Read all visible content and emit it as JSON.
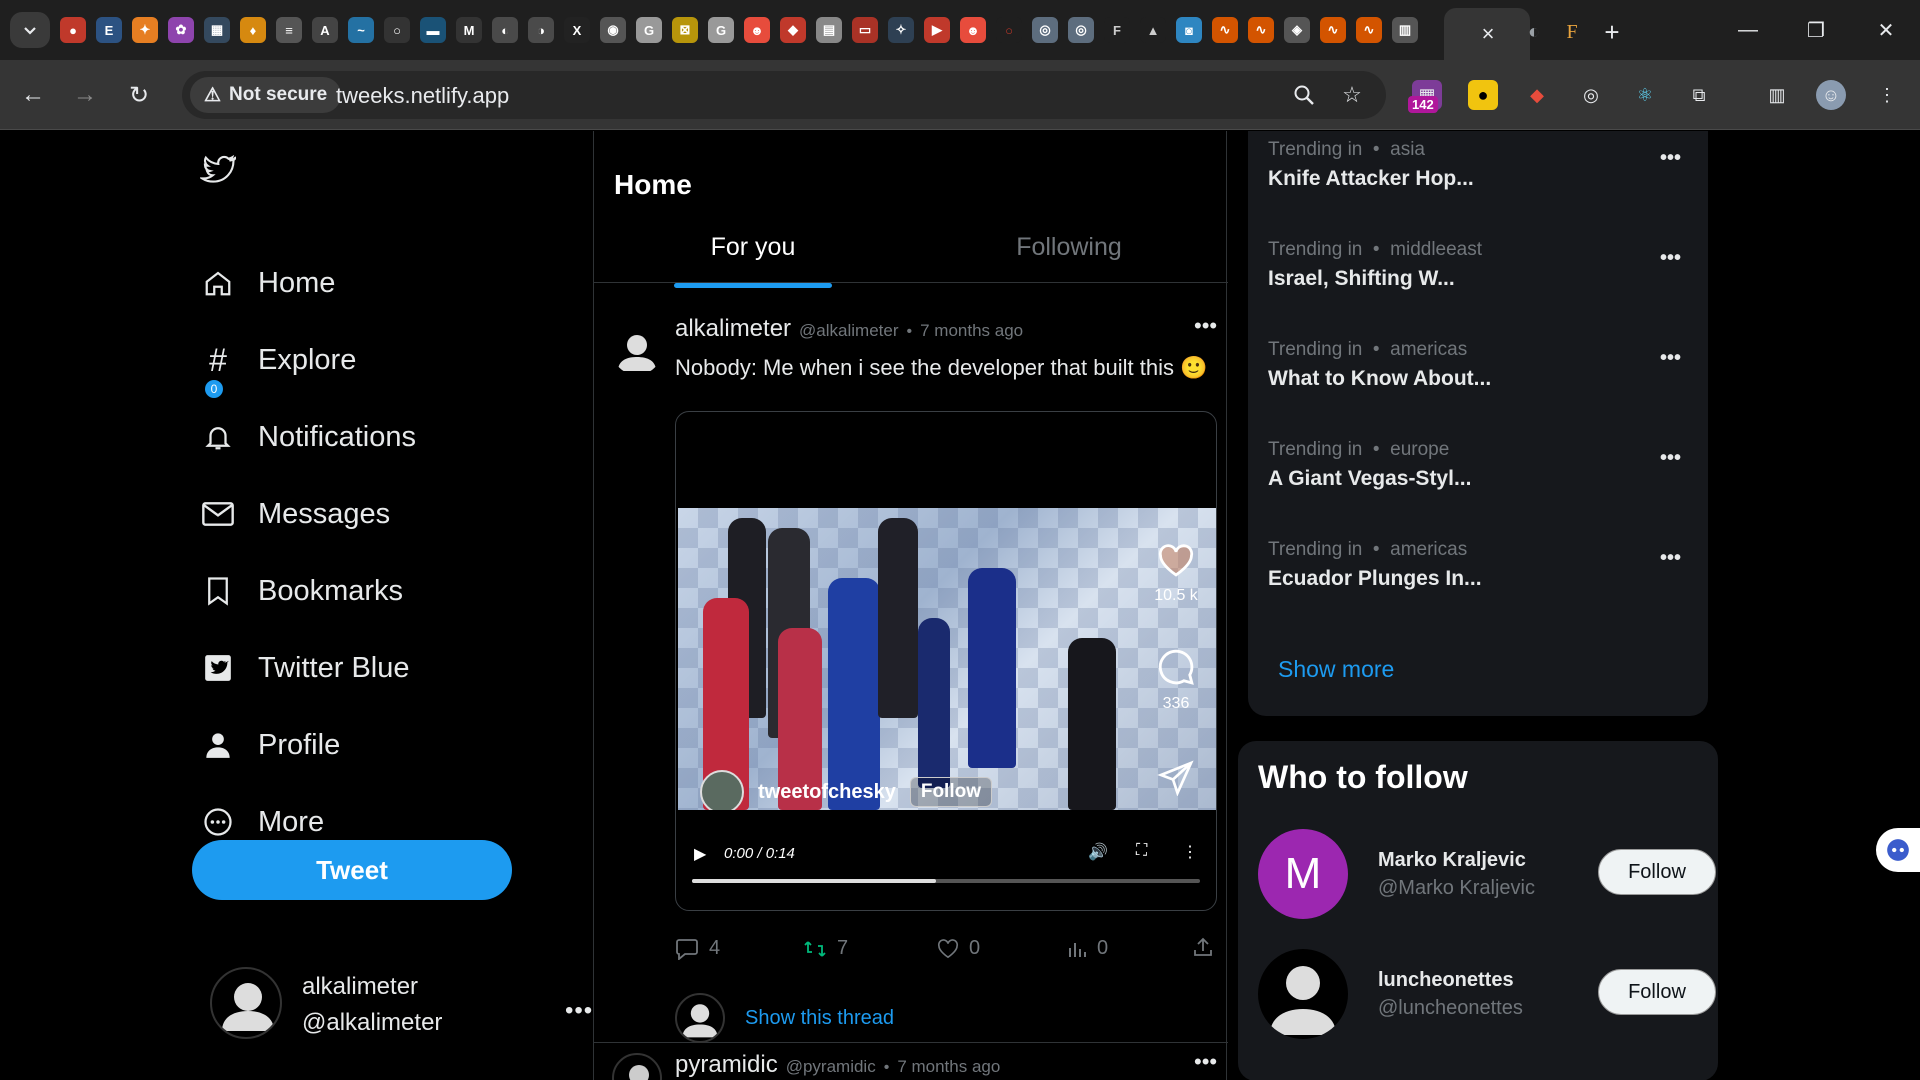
{
  "browser": {
    "tab_menu_icon": "chevron-down-icon",
    "active_tab_close": "×",
    "new_tab": "+",
    "window": {
      "minimize": "—",
      "restore": "❐",
      "close": "✕"
    },
    "security_label": "Not secure",
    "url": "tweeks.netlify.app",
    "extensions_badge": "142"
  },
  "sidebar": {
    "items": [
      {
        "label": "Home",
        "icon": "home-icon"
      },
      {
        "label": "Explore",
        "icon": "hashtag-icon"
      },
      {
        "label": "Notifications",
        "icon": "bell-icon"
      },
      {
        "label": "Messages",
        "icon": "mail-icon"
      },
      {
        "label": "Bookmarks",
        "icon": "bookmark-icon"
      },
      {
        "label": "Twitter Blue",
        "icon": "twitter-blue-icon"
      },
      {
        "label": "Profile",
        "icon": "person-icon"
      },
      {
        "label": "More",
        "icon": "more-circle-icon"
      }
    ],
    "notifications_count": "0",
    "tweet_button": "Tweet",
    "account": {
      "name": "alkalimeter",
      "handle": "@alkalimeter",
      "more": "•••"
    }
  },
  "feed": {
    "title": "Home",
    "tabs": [
      {
        "label": "For you",
        "active": true
      },
      {
        "label": "Following",
        "active": false
      }
    ],
    "tweet": {
      "name": "alkalimeter",
      "handle": "@alkalimeter",
      "dot": "•",
      "time": "7 months ago",
      "more": "•••",
      "text": "Nobody: Me when i see the developer that built this 🙂",
      "video": {
        "likes": "10.5 k",
        "comments": "336",
        "username": "tweetofchesky",
        "follow": "Follow",
        "time": "0:00 / 0:14",
        "progress": 0.48
      },
      "actions": {
        "replies": "4",
        "retweets": "7",
        "likes": "0",
        "views": "0"
      },
      "thread_link": "Show this thread"
    },
    "next_tweet": {
      "name": "pyramidic",
      "handle": "@pyramidic",
      "dot": "•",
      "time": "7 months ago",
      "more": "•••"
    }
  },
  "trends": [
    {
      "prefix": "Trending in",
      "region": "asia",
      "title": "Knife Attacker Hop..."
    },
    {
      "prefix": "Trending in",
      "region": "middleeast",
      "title": "Israel, Shifting W..."
    },
    {
      "prefix": "Trending in",
      "region": "americas",
      "title": "What to Know About..."
    },
    {
      "prefix": "Trending in",
      "region": "europe",
      "title": "A Giant Vegas-Styl..."
    },
    {
      "prefix": "Trending in",
      "region": "americas",
      "title": "Ecuador Plunges In..."
    }
  ],
  "trends_more": "•••",
  "trends_show_more": "Show more",
  "who_to_follow": {
    "title": "Who to follow",
    "users": [
      {
        "name": "Marko Kraljevic",
        "handle": "@Marko Kraljevic",
        "initial": "M",
        "follow": "Follow"
      },
      {
        "name": "luncheonettes",
        "handle": "@luncheonettes",
        "initial": "",
        "follow": "Follow"
      }
    ]
  },
  "colors": {
    "accent": "#1d9bf0",
    "background": "#000000",
    "card": "#16181c",
    "avatar_m": "#9c27b0"
  }
}
